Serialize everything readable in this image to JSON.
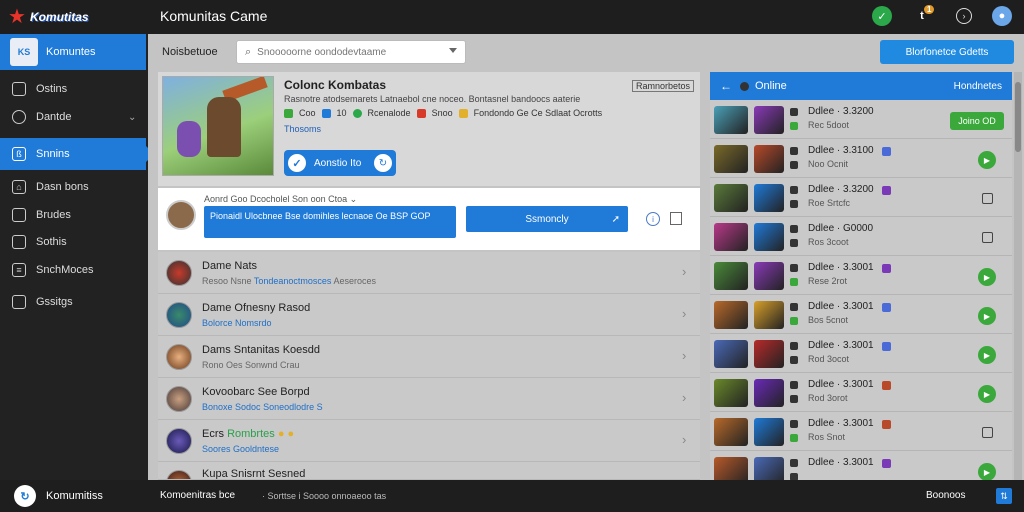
{
  "app": {
    "logo_text": "Komutitas",
    "title": "Komunitas Came"
  },
  "topbar": {
    "notif_badge": "1"
  },
  "sidebar": {
    "profile_name": "Komuntes",
    "profile_avatar_text": "KS",
    "items": [
      {
        "label": "Ostins",
        "icon": "gamepad-icon",
        "chevron": false
      },
      {
        "label": "Dantde",
        "icon": "chat-icon",
        "chevron": true
      },
      {
        "label": "Snnins",
        "icon": "users-icon",
        "active": true
      },
      {
        "label": "Dasn bons",
        "icon": "home-icon"
      },
      {
        "label": "Brudes",
        "icon": "inbox-icon"
      },
      {
        "label": "Sothis",
        "icon": "folder-icon"
      },
      {
        "label": "SnchMoces",
        "icon": "list-icon"
      },
      {
        "label": "Gssitgs",
        "icon": "monitor-icon"
      }
    ]
  },
  "main": {
    "nav_label": "Noisbetuoe",
    "search_placeholder": "Snooooorne oondodevtaame",
    "primary_button": "Blorfonetce Gdetts"
  },
  "game": {
    "title": "Colonc Kombatas",
    "tag": "Ramnorbetos",
    "description": "Rasnotre atodsemarets Latnaebol cne noceo. Bontasnel bandoocs aaterie",
    "meta": [
      "Coo",
      "10",
      "Rcenalode",
      "Snoo",
      "Fondondo Ge Ce Sdlaat Ocrotts"
    ],
    "link": "Thosoms",
    "play_label": "Aonstio Ito"
  },
  "composer": {
    "header": "Aonrd Goo Dcocholel Son oon Ctoa",
    "input_text": "Pionaidl Ulocbnee Bse domihles lecnaoe Oe BSP GOP",
    "send_label": "Ssmoncly"
  },
  "feed": [
    {
      "title": "Dame Nats",
      "title_hl": "",
      "sub": "Resoo Nsne",
      "sub_hl": "Tondeanoctmosces",
      "sub_rest": "Aeseroces"
    },
    {
      "title": "Dame Ofnesny Rasod",
      "title_hl": "",
      "sub": "Bolorce Nomsrdo",
      "sub_hl": "",
      "sub_rest": ""
    },
    {
      "title": "Dams Sntanitas Koesdd",
      "title_hl": "",
      "sub": "Rono Oes Sonwnd Crau",
      "sub_hl": "",
      "sub_rest": ""
    },
    {
      "title": "Kovoobarc See Borpd",
      "title_hl": "",
      "sub": "Bonoxe Sodoc",
      "sub_hl": "",
      "sub_rest": "Soneodlodre S"
    },
    {
      "title": "Ecrs",
      "title_hl": "Rombrtes",
      "sub": "Soores Gooldntese",
      "sub_hl": "",
      "sub_rest": ""
    },
    {
      "title": "Kupa Snisrnt Sesned",
      "title_hl": "",
      "sub": "",
      "sub_hl": "",
      "sub_rest": ""
    }
  ],
  "online": {
    "header": "Online",
    "header_action": "Hondnetes",
    "join_label": "Joino OD",
    "players": [
      {
        "name": "Ddlee · 3.3200",
        "sub": "Rec 5doot",
        "action": "join",
        "c1": "#4aa0b8",
        "c2": "#8a3ab8",
        "ps2": "#3aa83a",
        "ico": ""
      },
      {
        "name": "Ddlee · 3.3100",
        "sub": "Noo Ocnit",
        "action": "play",
        "c1": "#7a6a2a",
        "c2": "#b84a2a",
        "ps2": "#333",
        "ico": "#4a6ad8"
      },
      {
        "name": "Ddlee · 3.3200",
        "sub": "Roe Srtcfc",
        "action": "opt",
        "c1": "#5a7a3a",
        "c2": "#1f7ad8",
        "ps2": "#333",
        "ico": "#7a3ab8"
      },
      {
        "name": "Ddlee · G0000",
        "sub": "Ros 3coot",
        "action": "opt",
        "c1": "#b83a8a",
        "c2": "#1f7ad8",
        "ps2": "#333",
        "ico": ""
      },
      {
        "name": "Ddlee · 3.3001",
        "sub": "Rese 2rot",
        "action": "play",
        "c1": "#4a8a3a",
        "c2": "#8a3ab8",
        "ps2": "#3aa83a",
        "ico": "#7a3ab8"
      },
      {
        "name": "Ddlee · 3.3001",
        "sub": "Bos 5cnot",
        "action": "play",
        "c1": "#b86a2a",
        "c2": "#d8a02a",
        "ps2": "#3aa83a",
        "ico": "#4a6ad8"
      },
      {
        "name": "Ddlee · 3.3001",
        "sub": "Rod 3ocot",
        "action": "play",
        "c1": "#4a6ab8",
        "c2": "#b82a2a",
        "ps2": "#333",
        "ico": "#4a6ad8"
      },
      {
        "name": "Ddlee · 3.3001",
        "sub": "Rod 3orot",
        "action": "play",
        "c1": "#6a8a2a",
        "c2": "#6a2ab8",
        "ps2": "#333",
        "ico": "#b84a2a"
      },
      {
        "name": "Ddlee · 3.3001",
        "sub": "Ros Snot",
        "action": "opt",
        "c1": "#b86a2a",
        "c2": "#1f7ad8",
        "ps2": "#3aa83a",
        "ico": "#b84a2a"
      },
      {
        "name": "Ddlee · 3.3001",
        "sub": "",
        "action": "play",
        "c1": "#b85a2a",
        "c2": "#4a6ab8",
        "ps2": "#333",
        "ico": "#7a3ab8"
      }
    ]
  },
  "bottombar": {
    "name": "Komumitiss",
    "title": "Komoenitras bce",
    "subtitle": "Sorttse i Soooo onnoaeoo tas",
    "right_label": "Boonoos"
  }
}
